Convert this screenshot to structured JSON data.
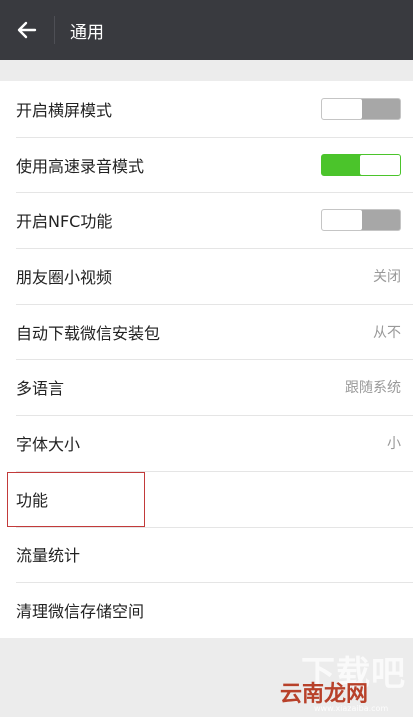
{
  "header": {
    "title": "通用",
    "back_icon": "back-arrow-icon"
  },
  "settings": [
    {
      "label": "开启横屏模式",
      "type": "toggle",
      "state": "off"
    },
    {
      "label": "使用高速录音模式",
      "type": "toggle",
      "state": "on"
    },
    {
      "label": "开启NFC功能",
      "type": "toggle",
      "state": "off"
    },
    {
      "label": "朋友圈小视频",
      "type": "value",
      "value": "关闭"
    },
    {
      "label": "自动下载微信安装包",
      "type": "value",
      "value": "从不"
    },
    {
      "label": "多语言",
      "type": "value",
      "value": "跟随系统"
    },
    {
      "label": "字体大小",
      "type": "value",
      "value": "小"
    },
    {
      "label": "功能",
      "type": "none"
    },
    {
      "label": "流量统计",
      "type": "none"
    },
    {
      "label": "清理微信存储空间",
      "type": "none"
    }
  ],
  "watermark": {
    "top": "下载吧",
    "mid": "云南龙网",
    "bottom": "www.xiazaiba.com"
  },
  "colors": {
    "topbar": "#393a3f",
    "toggle_on": "#4bc42b",
    "toggle_off": "#a7a7a7",
    "highlight": "#c23a3a"
  }
}
